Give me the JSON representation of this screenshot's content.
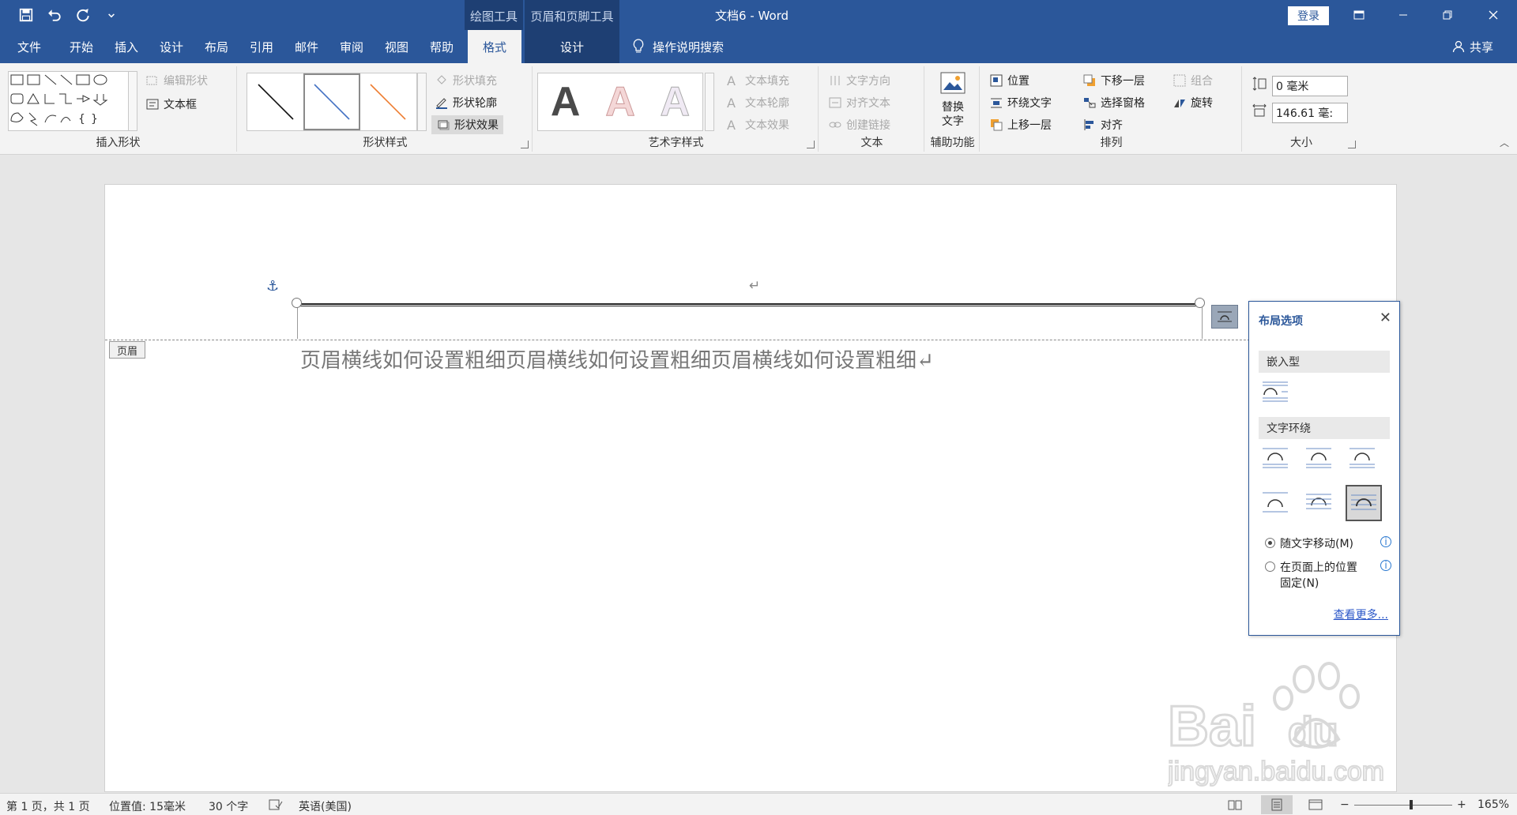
{
  "window": {
    "title": "文档6  -  Word",
    "login_label": "登录"
  },
  "context_groups": {
    "drawing_tools": "绘图工具",
    "header_footer_tools": "页眉和页脚工具"
  },
  "tabs": [
    {
      "label": "文件"
    },
    {
      "label": "开始"
    },
    {
      "label": "插入"
    },
    {
      "label": "设计"
    },
    {
      "label": "布局"
    },
    {
      "label": "引用"
    },
    {
      "label": "邮件"
    },
    {
      "label": "审阅"
    },
    {
      "label": "视图"
    },
    {
      "label": "帮助"
    },
    {
      "label": "格式",
      "active": true
    },
    {
      "label": "设计"
    }
  ],
  "tell_me": "操作说明搜索",
  "share_label": "共享",
  "ribbon": {
    "insert_shapes": {
      "label": "插入形状",
      "edit_shape": "编辑形状",
      "text_box": "文本框"
    },
    "shape_styles": {
      "label": "形状样式",
      "fill": "形状填充",
      "outline": "形状轮廓",
      "effects": "形状效果"
    },
    "wordart": {
      "label": "艺术字样式",
      "sample": "A",
      "text_fill": "文本填充",
      "text_outline": "文本轮廓",
      "text_effects": "文本效果"
    },
    "text": {
      "label": "文本",
      "direction": "文字方向",
      "align": "对齐文本",
      "link": "创建链接"
    },
    "accessibility": {
      "label": "辅助功能",
      "alt_text_line1": "替换",
      "alt_text_line2": "文字"
    },
    "arrange": {
      "label": "排列",
      "position": "位置",
      "wrap": "环绕文字",
      "bring_forward": "上移一层",
      "send_backward": "下移一层",
      "selection_pane": "选择窗格",
      "align": "对齐",
      "group": "组合",
      "rotate": "旋转"
    },
    "size": {
      "label": "大小",
      "height": "0 毫米",
      "width": "146.61 毫:"
    }
  },
  "document": {
    "header_tag": "页眉",
    "header_text": "页眉横线如何设置粗细页眉横线如何设置粗细页眉横线如何设置粗细↵",
    "para_mark": "↵"
  },
  "layout_options": {
    "title": "布局选项",
    "inline_section": "嵌入型",
    "wrap_section": "文字环绕",
    "move_with_text": "随文字移动(M)",
    "fix_position_line1": "在页面上的位置",
    "fix_position_line2": "固定(N)",
    "see_more": "查看更多..."
  },
  "status": {
    "page": "第 1 页，共 1 页",
    "position": "位置值: 15毫米",
    "words": "30 个字",
    "language": "英语(美国)",
    "zoom_minus": "−",
    "zoom_plus": "+",
    "zoom": "165%"
  },
  "colors": {
    "brand": "#2b579a",
    "context_tab": "#1e3f73"
  }
}
